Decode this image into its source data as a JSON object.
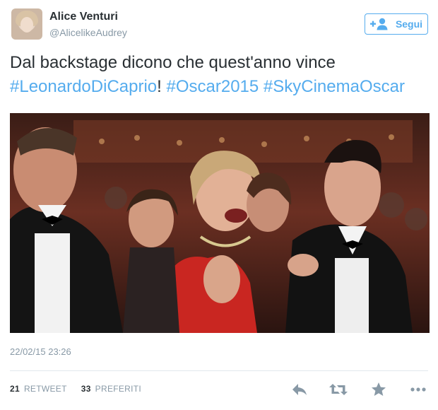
{
  "user": {
    "name": "Alice Venturi",
    "handle": "@AlicelikeAudrey"
  },
  "follow_button": {
    "label": "Segui"
  },
  "tweet": {
    "text_plain": "Dal backstage dicono che quest'anno vince",
    "hashtag1": "#LeonardoDiCaprio",
    "exclamation": "!",
    "hashtag2": "#Oscar2015",
    "hashtag3": "#SkyCinemaOscar",
    "timestamp": "22/02/15 23:26"
  },
  "stats": {
    "retweets_count": "21",
    "retweets_label": "RETWEET",
    "favorites_count": "33",
    "favorites_label": "PREFERITI"
  },
  "icons": {
    "reply": "reply-icon",
    "retweet": "retweet-icon",
    "favorite": "star-icon",
    "more": "more-icon",
    "follow": "add-user-icon"
  },
  "colors": {
    "accent": "#55acee",
    "text": "#292f33",
    "muted": "#8899a6"
  }
}
